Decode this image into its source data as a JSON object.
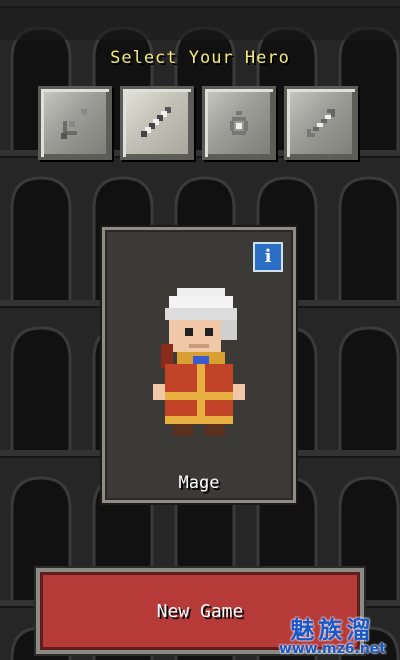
{
  "screen": {
    "title": "Select Your Hero"
  },
  "classes": [
    {
      "name": "warrior",
      "icon": "sword-icon",
      "selected": false
    },
    {
      "name": "mage",
      "icon": "staff-icon",
      "selected": true
    },
    {
      "name": "rogue",
      "icon": "ring-icon",
      "selected": false
    },
    {
      "name": "huntress",
      "icon": "arrow-icon",
      "selected": false
    }
  ],
  "hero_card": {
    "info_label": "i",
    "hero_name": "Mage"
  },
  "actions": {
    "new_game_label": "New Game"
  },
  "watermark": {
    "brand": "魅族溜",
    "url": "www.mz6.net"
  },
  "colors": {
    "title": "#f2ea7a",
    "new_game_bg": "#b53a38",
    "info_bg": "#2a6fc4",
    "background": "#1c1c1c"
  }
}
